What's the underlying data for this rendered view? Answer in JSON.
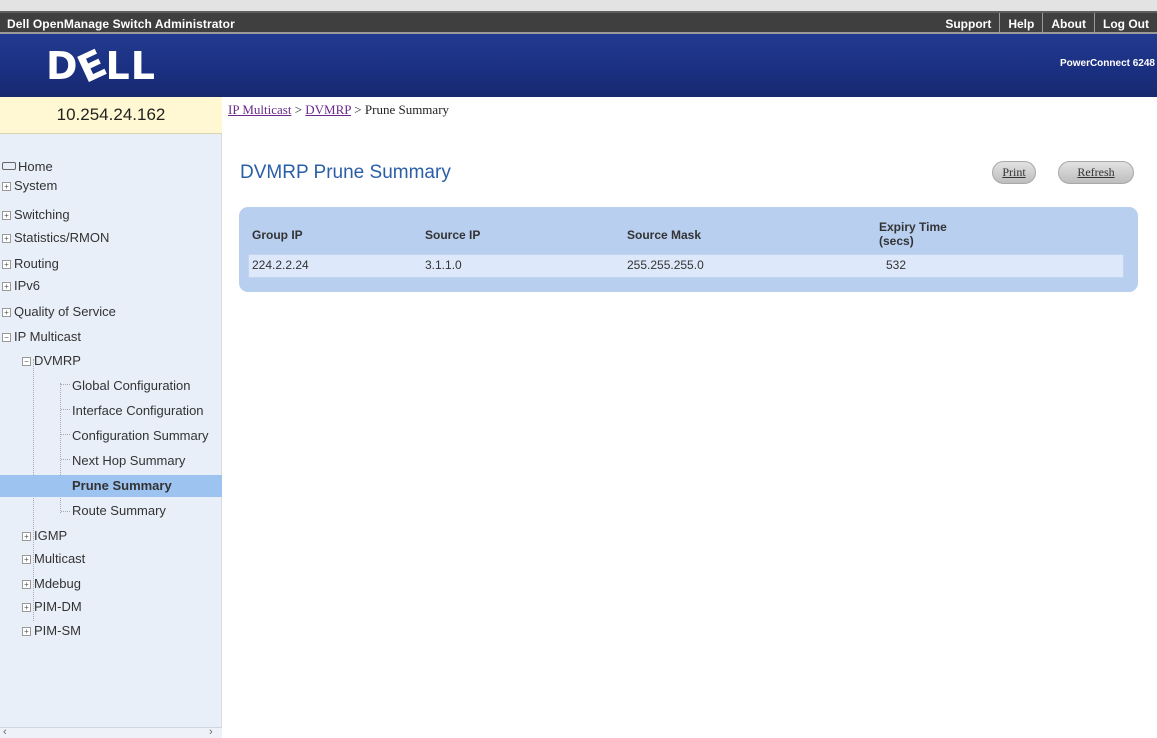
{
  "app_title": "Dell OpenManage Switch Administrator",
  "top_links": [
    "Support",
    "Help",
    "About",
    "Log Out"
  ],
  "brand": {
    "logo": "DELL",
    "product": "PowerConnect 6248"
  },
  "nav": {
    "ip": "10.254.24.162",
    "items": [
      {
        "label": "Home"
      },
      {
        "label": "System"
      },
      {
        "label": "Switching"
      },
      {
        "label": "Statistics/RMON"
      },
      {
        "label": "Routing"
      },
      {
        "label": "IPv6"
      },
      {
        "label": "Quality of Service"
      },
      {
        "label": "IP Multicast"
      },
      {
        "label": "DVMRP"
      },
      {
        "label": "Global Configuration"
      },
      {
        "label": "Interface Configuration"
      },
      {
        "label": "Configuration Summary"
      },
      {
        "label": "Next Hop Summary"
      },
      {
        "label": "Prune Summary"
      },
      {
        "label": "Route Summary"
      },
      {
        "label": "IGMP"
      },
      {
        "label": "Multicast"
      },
      {
        "label": "Mdebug"
      },
      {
        "label": "PIM-DM"
      },
      {
        "label": "PIM-SM"
      }
    ]
  },
  "breadcrumb": {
    "part1": "IP Multicast",
    "sep": " > ",
    "part2": "DVMRP",
    "current": "Prune Summary"
  },
  "page_title": "DVMRP Prune Summary",
  "buttons": {
    "print": "Print",
    "refresh": "Refresh"
  },
  "table": {
    "headers": [
      "Group IP",
      "Source IP",
      "Source Mask",
      "Expiry Time",
      "(secs)"
    ],
    "rows": [
      [
        "224.2.2.24",
        "3.1.1.0",
        "255.255.255.0",
        "532"
      ]
    ]
  },
  "colors": {
    "banner": "#1f3488",
    "title": "#2a5fa8",
    "panel": "#b8cff0",
    "selected": "#9dc3f0"
  }
}
